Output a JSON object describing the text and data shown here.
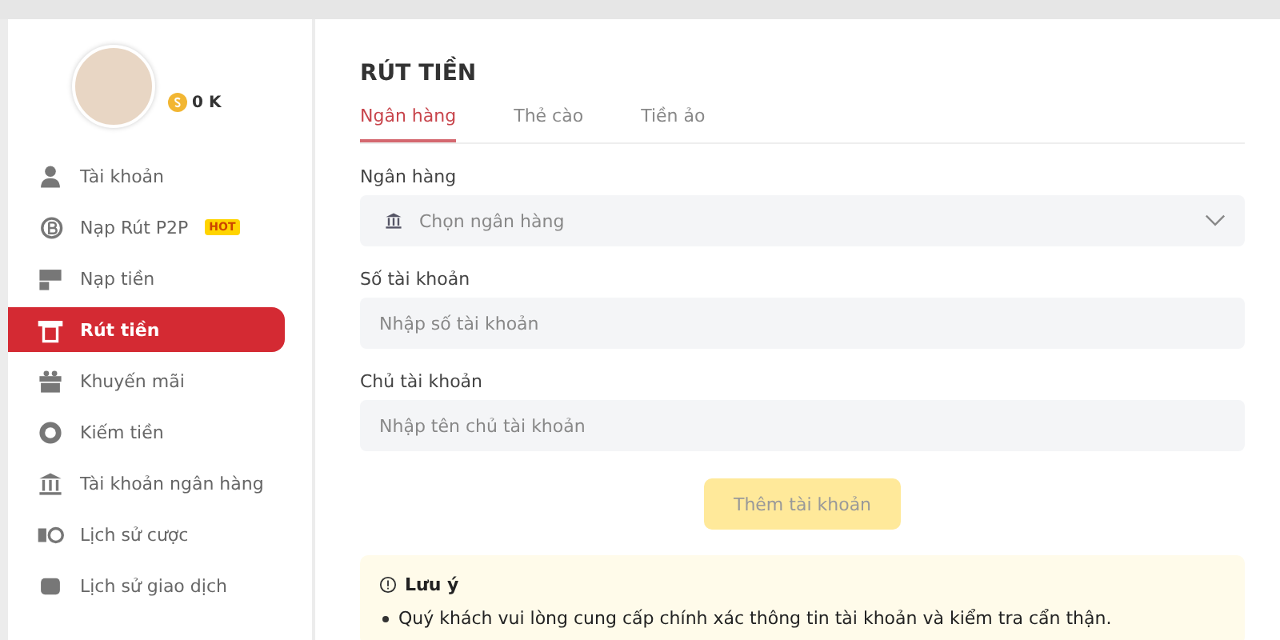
{
  "profile": {
    "balance": "0 K"
  },
  "sidebar": {
    "items": [
      {
        "label": "Tài khoản",
        "selected": false
      },
      {
        "label": "Nạp Rút P2P",
        "badge": "HOT",
        "selected": false
      },
      {
        "label": "Nạp tiền",
        "selected": false
      },
      {
        "label": "Rút tiền",
        "selected": true
      },
      {
        "label": "Khuyến mãi",
        "selected": false
      },
      {
        "label": "Kiếm tiền",
        "selected": false
      },
      {
        "label": "Tài khoản ngân hàng",
        "selected": false
      },
      {
        "label": "Lịch sử cược",
        "selected": false
      },
      {
        "label": "Lịch sử giao dịch",
        "selected": false
      }
    ]
  },
  "page_title": "RÚT TIỀN",
  "tabs": [
    {
      "label": "Ngân hàng",
      "selected": true
    },
    {
      "label": "Thẻ cào",
      "selected": false
    },
    {
      "label": "Tiền ảo",
      "selected": false
    }
  ],
  "form": {
    "bank": {
      "label": "Ngân hàng",
      "placeholder": "Chọn ngân hàng"
    },
    "account_number": {
      "label": "Số tài khoản",
      "placeholder": "Nhập số tài khoản"
    },
    "account_holder": {
      "label": "Chủ tài khoản",
      "placeholder": "Nhập tên chủ tài khoản"
    },
    "submit": {
      "label": "Thêm tài khoản",
      "disabled": true
    }
  },
  "note": {
    "title": "Lưu ý",
    "items": [
      "Quý khách vui lòng cung cấp chính xác thông tin tài khoản và kiểm tra cẩn thận."
    ]
  }
}
